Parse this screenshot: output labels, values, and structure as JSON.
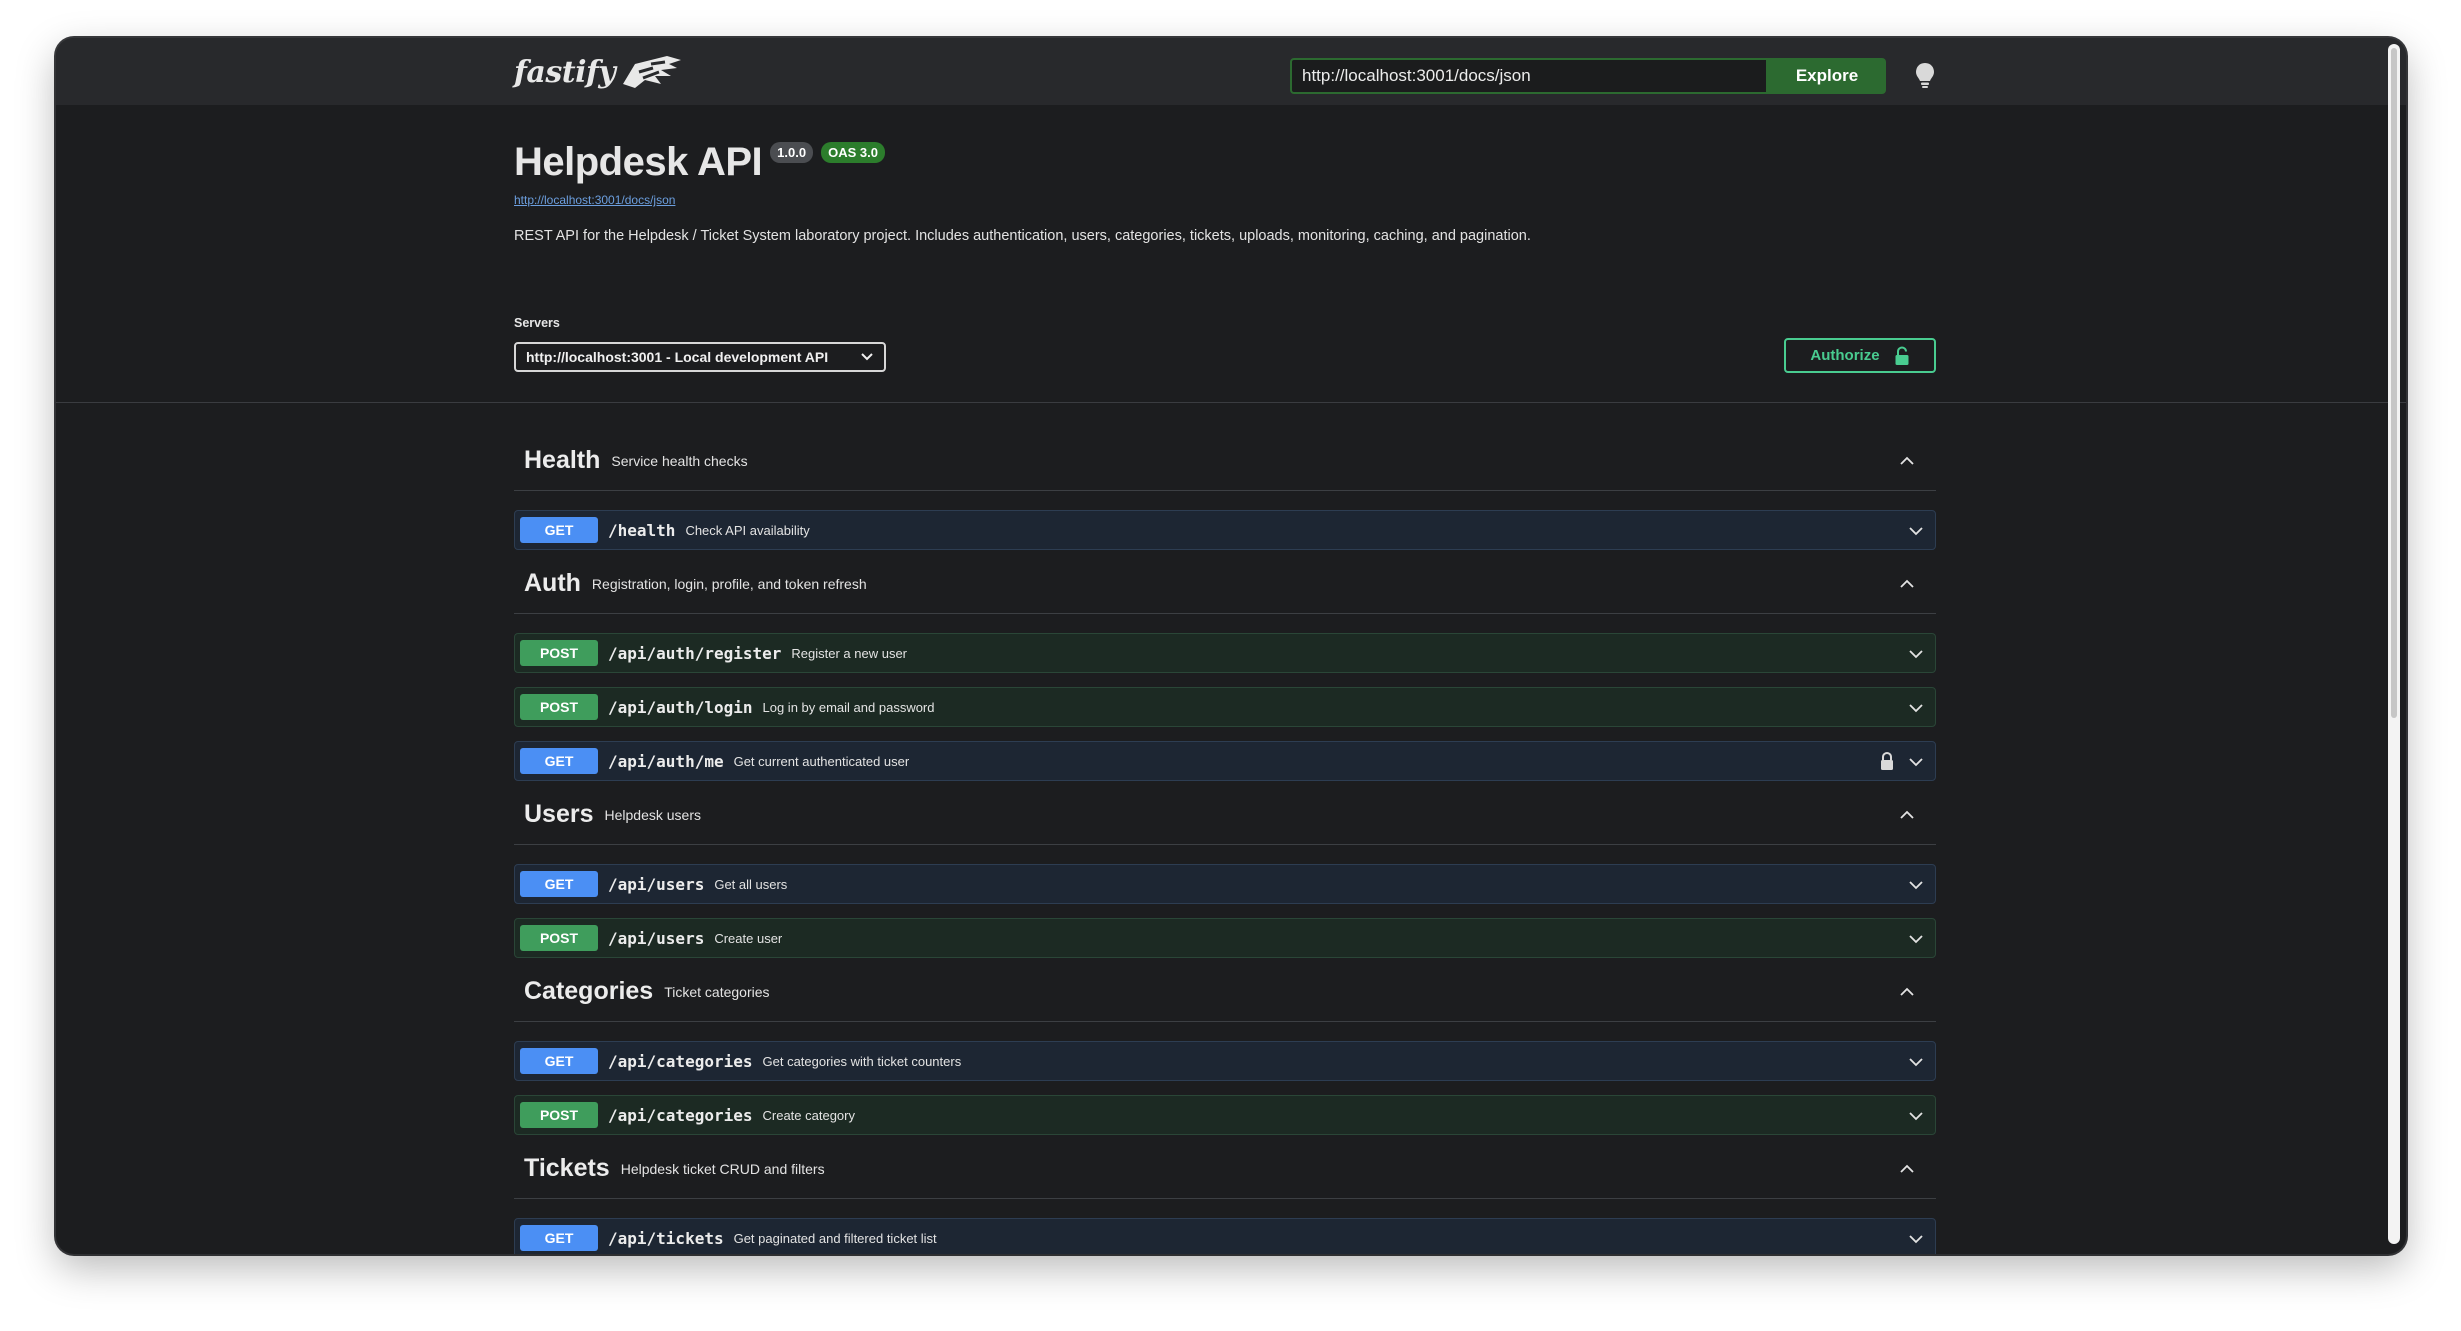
{
  "topbar": {
    "logo_text": "fastify",
    "url_value": "http://localhost:3001/docs/json",
    "explore_label": "Explore"
  },
  "info": {
    "title": "Helpdesk API",
    "version": "1.0.0",
    "oas": "OAS 3.0",
    "spec_link": "http://localhost:3001/docs/json",
    "description": "REST API for the Helpdesk / Ticket System laboratory project. Includes authentication, users, categories, tickets, uploads, monitoring, caching, and pagination."
  },
  "servers": {
    "label": "Servers",
    "selected": "http://localhost:3001 - Local development API"
  },
  "authorize_label": "Authorize",
  "tags": [
    {
      "name": "Health",
      "description": "Service health checks",
      "operations": [
        {
          "method": "GET",
          "path": "/health",
          "summary": "Check API availability",
          "locked": false
        }
      ]
    },
    {
      "name": "Auth",
      "description": "Registration, login, profile, and token refresh",
      "operations": [
        {
          "method": "POST",
          "path": "/api/auth/register",
          "summary": "Register a new user",
          "locked": false
        },
        {
          "method": "POST",
          "path": "/api/auth/login",
          "summary": "Log in by email and password",
          "locked": false
        },
        {
          "method": "GET",
          "path": "/api/auth/me",
          "summary": "Get current authenticated user",
          "locked": true
        }
      ]
    },
    {
      "name": "Users",
      "description": "Helpdesk users",
      "operations": [
        {
          "method": "GET",
          "path": "/api/users",
          "summary": "Get all users",
          "locked": false
        },
        {
          "method": "POST",
          "path": "/api/users",
          "summary": "Create user",
          "locked": false
        }
      ]
    },
    {
      "name": "Categories",
      "description": "Ticket categories",
      "operations": [
        {
          "method": "GET",
          "path": "/api/categories",
          "summary": "Get categories with ticket counters",
          "locked": false
        },
        {
          "method": "POST",
          "path": "/api/categories",
          "summary": "Create category",
          "locked": false
        }
      ]
    },
    {
      "name": "Tickets",
      "description": "Helpdesk ticket CRUD and filters",
      "operations": [
        {
          "method": "GET",
          "path": "/api/tickets",
          "summary": "Get paginated and filtered ticket list",
          "locked": false
        }
      ]
    }
  ]
}
